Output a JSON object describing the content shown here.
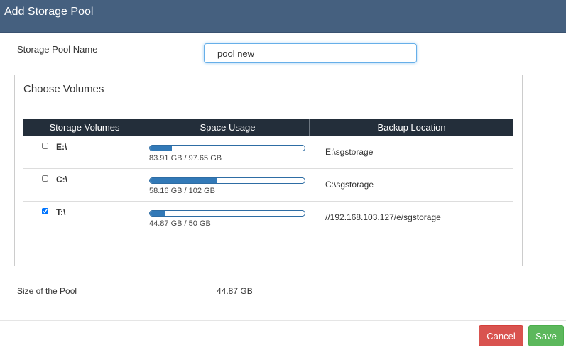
{
  "dialog": {
    "title": "Add Storage Pool"
  },
  "pool_name": {
    "label": "Storage Pool Name",
    "value": "pool new"
  },
  "volumes": {
    "title": "Choose Volumes",
    "columns": [
      "Storage Volumes",
      "Space Usage",
      "Backup Location"
    ],
    "rows": [
      {
        "name": "E:\\",
        "checked": false,
        "usage_text": "83.91 GB / 97.65 GB",
        "usage_fraction": 0.14,
        "backup_location": "E:\\sgstorage"
      },
      {
        "name": "C:\\",
        "checked": false,
        "usage_text": "58.16 GB / 102 GB",
        "usage_fraction": 0.43,
        "backup_location": "C:\\sgstorage"
      },
      {
        "name": "T:\\",
        "checked": true,
        "usage_text": "44.87 GB / 50 GB",
        "usage_fraction": 0.1,
        "backup_location": "//192.168.103.127/e/sgstorage"
      }
    ]
  },
  "pool_size": {
    "label": "Size of the Pool",
    "value": "44.87 GB"
  },
  "buttons": {
    "cancel": "Cancel",
    "save": "Save"
  },
  "colors": {
    "header": "#45607f",
    "table_header": "#232e3a",
    "bar_fill": "#3279b7",
    "cancel": "#d9534f",
    "save": "#5cb85c"
  }
}
